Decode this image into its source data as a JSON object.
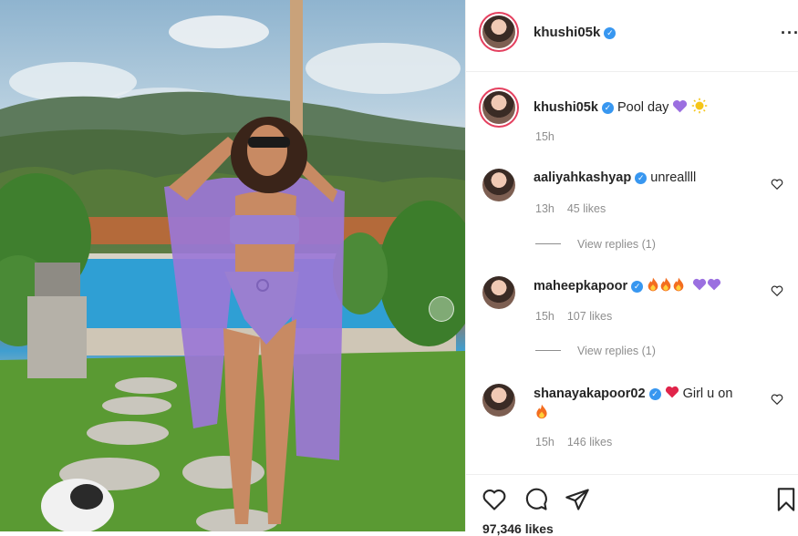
{
  "post": {
    "author": "khushi05k",
    "caption": "Pool day",
    "caption_emojis": [
      "purple-heart-icon",
      "sun-icon"
    ],
    "caption_time": "15h",
    "like_count": "97,346 likes",
    "verified": true
  },
  "comments": [
    {
      "username": "aaliyahkashyap",
      "text": "unreallll",
      "time": "13h",
      "likes": "45 likes",
      "view_replies": "View replies (1)"
    },
    {
      "username": "maheepkapoor",
      "text": "",
      "emojis": [
        "fire-icon",
        "fire-icon",
        "fire-icon",
        "purple-heart-icon",
        "purple-heart-icon"
      ],
      "time": "15h",
      "likes": "107 likes",
      "view_replies": "View replies (1)"
    },
    {
      "username": "shanayakapoor02",
      "text": "Girl u on",
      "emojis": [
        "red-heart-icon",
        "fire-icon"
      ],
      "time": "15h",
      "likes": "146 likes"
    }
  ],
  "colors": {
    "verified": "#3897f0",
    "story_ring": "#e4405f",
    "muted": "#8e8e8e",
    "purple": "#9b6fe0"
  }
}
